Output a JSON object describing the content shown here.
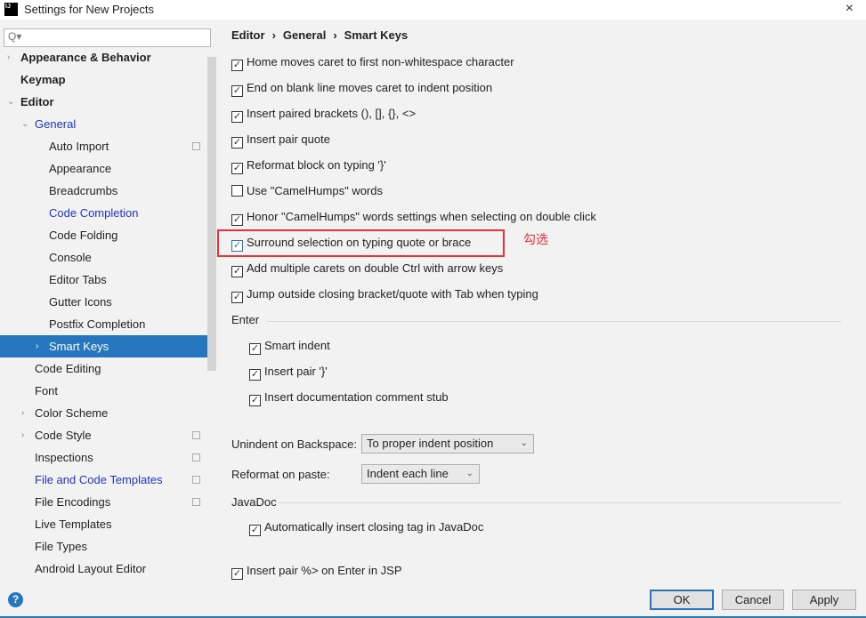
{
  "window": {
    "title": "Settings for New Projects",
    "logo_text": "IJ",
    "close_icon": "×"
  },
  "search": {
    "icon": "Q▾",
    "value": ""
  },
  "tree": [
    {
      "label": "Appearance & Behavior",
      "level": 0,
      "arrow": "›",
      "bold": true
    },
    {
      "label": "Keymap",
      "level": 0,
      "bold": true
    },
    {
      "label": "Editor",
      "level": 0,
      "arrow": "⌄",
      "bold": true
    },
    {
      "label": "General",
      "level": 1,
      "arrow": "⌄",
      "blue": true
    },
    {
      "label": "Auto Import",
      "level": 2,
      "copy": true
    },
    {
      "label": "Appearance",
      "level": 2
    },
    {
      "label": "Breadcrumbs",
      "level": 2
    },
    {
      "label": "Code Completion",
      "level": 2,
      "blue": true
    },
    {
      "label": "Code Folding",
      "level": 2
    },
    {
      "label": "Console",
      "level": 2
    },
    {
      "label": "Editor Tabs",
      "level": 2
    },
    {
      "label": "Gutter Icons",
      "level": 2
    },
    {
      "label": "Postfix Completion",
      "level": 2
    },
    {
      "label": "Smart Keys",
      "level": 2,
      "arrow": "›",
      "selected": true
    },
    {
      "label": "Code Editing",
      "level": 1
    },
    {
      "label": "Font",
      "level": 1
    },
    {
      "label": "Color Scheme",
      "level": 1,
      "arrow": "›"
    },
    {
      "label": "Code Style",
      "level": 1,
      "arrow": "›",
      "copy": true
    },
    {
      "label": "Inspections",
      "level": 1,
      "copy": true
    },
    {
      "label": "File and Code Templates",
      "level": 1,
      "blue": true,
      "copy": true
    },
    {
      "label": "File Encodings",
      "level": 1,
      "copy": true
    },
    {
      "label": "Live Templates",
      "level": 1
    },
    {
      "label": "File Types",
      "level": 1
    },
    {
      "label": "Android Layout Editor",
      "level": 1
    }
  ],
  "breadcrumb": [
    "Editor",
    "General",
    "Smart Keys"
  ],
  "breadcrumb_sep": "›",
  "options": [
    {
      "label": "Home moves caret to first non-whitespace character",
      "checked": true
    },
    {
      "label": "End on blank line moves caret to indent position",
      "checked": true
    },
    {
      "label": "Insert paired brackets (), [], {}, <>",
      "checked": true
    },
    {
      "label": "Insert pair quote",
      "checked": true
    },
    {
      "label": "Reformat block on typing '}'",
      "checked": true
    },
    {
      "label": "Use \"CamelHumps\" words",
      "checked": false
    },
    {
      "label": "Honor \"CamelHumps\" words settings when selecting on double click",
      "checked": true
    },
    {
      "label": "Surround selection on typing quote or brace",
      "checked": true,
      "highlighted": true
    },
    {
      "label": "Add multiple carets on double Ctrl with arrow keys",
      "checked": true
    },
    {
      "label": "Jump outside closing bracket/quote with Tab when typing",
      "checked": true
    }
  ],
  "annotation": "勾选",
  "enter": {
    "title": "Enter",
    "options": [
      {
        "label": "Smart indent",
        "checked": true
      },
      {
        "label": "Insert pair '}'",
        "checked": true
      },
      {
        "label": "Insert documentation comment stub",
        "checked": true
      }
    ]
  },
  "unindent": {
    "label": "Unindent on Backspace:",
    "value": "To proper indent position"
  },
  "reformat": {
    "label": "Reformat on paste:",
    "value": "Indent each line"
  },
  "javadoc": {
    "title": "JavaDoc",
    "option": {
      "label": "Automatically insert closing tag in JavaDoc",
      "checked": true
    }
  },
  "jsp": {
    "label": "Insert pair %> on Enter in JSP",
    "checked": true
  },
  "footer": {
    "help": "?",
    "ok": "OK",
    "cancel": "Cancel",
    "apply": "Apply"
  },
  "colors": {
    "accent": "#2675bf",
    "annotation": "#e8333a",
    "link": "#2135c7"
  }
}
